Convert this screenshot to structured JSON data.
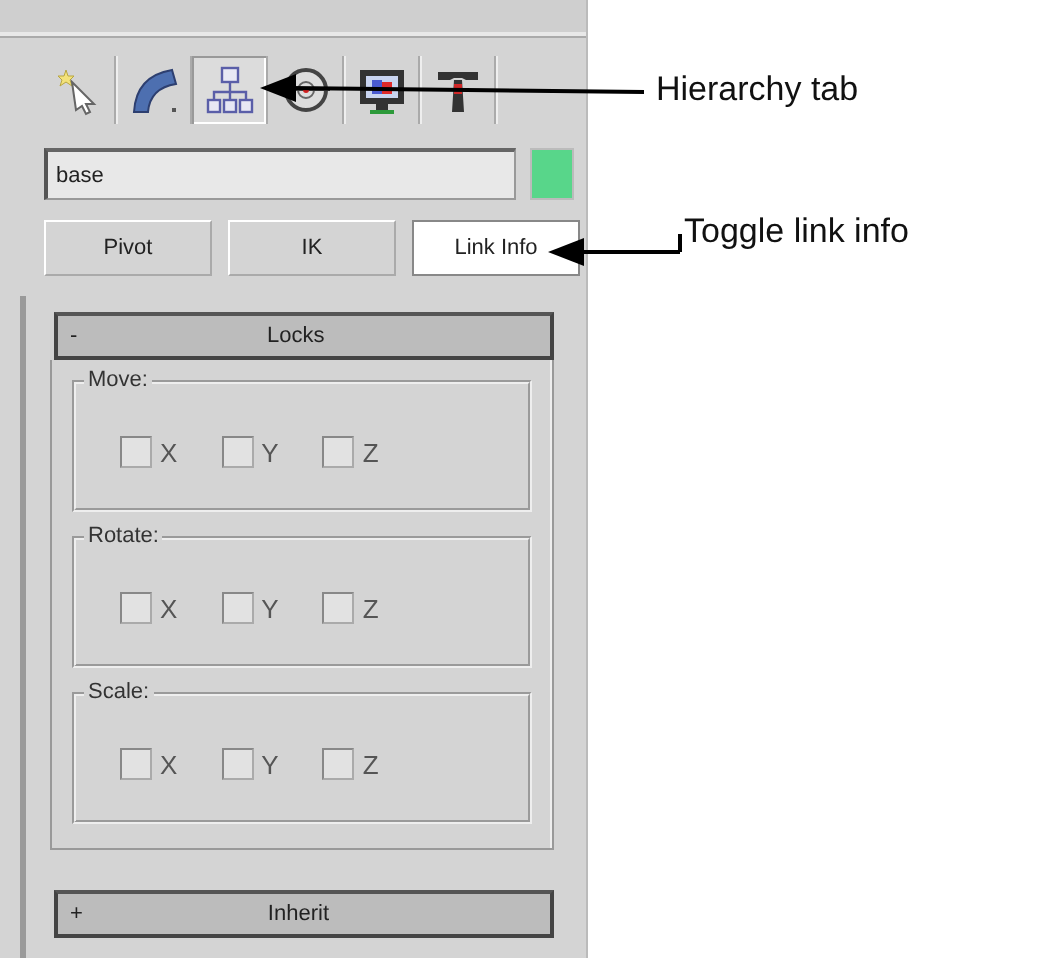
{
  "tabs": [
    {
      "kind": "create",
      "selected": false
    },
    {
      "kind": "modify",
      "selected": false
    },
    {
      "kind": "hierarchy",
      "selected": true
    },
    {
      "kind": "motion",
      "selected": false
    },
    {
      "kind": "display",
      "selected": false
    },
    {
      "kind": "utilities",
      "selected": false
    }
  ],
  "object": {
    "name": "base",
    "color": "#58d68a"
  },
  "modes": [
    {
      "label": "Pivot",
      "selected": false
    },
    {
      "label": "IK",
      "selected": false
    },
    {
      "label": "Link Info",
      "selected": true
    }
  ],
  "rollouts": [
    {
      "sign": "-",
      "title": "Locks",
      "groups": [
        {
          "title": "Move:",
          "axes": [
            {
              "label": "X",
              "checked": false
            },
            {
              "label": "Y",
              "checked": false
            },
            {
              "label": "Z",
              "checked": false
            }
          ]
        },
        {
          "title": "Rotate:",
          "axes": [
            {
              "label": "X",
              "checked": false
            },
            {
              "label": "Y",
              "checked": false
            },
            {
              "label": "Z",
              "checked": false
            }
          ]
        },
        {
          "title": "Scale:",
          "axes": [
            {
              "label": "X",
              "checked": false
            },
            {
              "label": "Y",
              "checked": false
            },
            {
              "label": "Z",
              "checked": false
            }
          ]
        }
      ]
    },
    {
      "sign": "+",
      "title": "Inherit"
    }
  ],
  "annotations": [
    {
      "text": "Hierarchy tab"
    },
    {
      "text": "Toggle link info"
    }
  ]
}
